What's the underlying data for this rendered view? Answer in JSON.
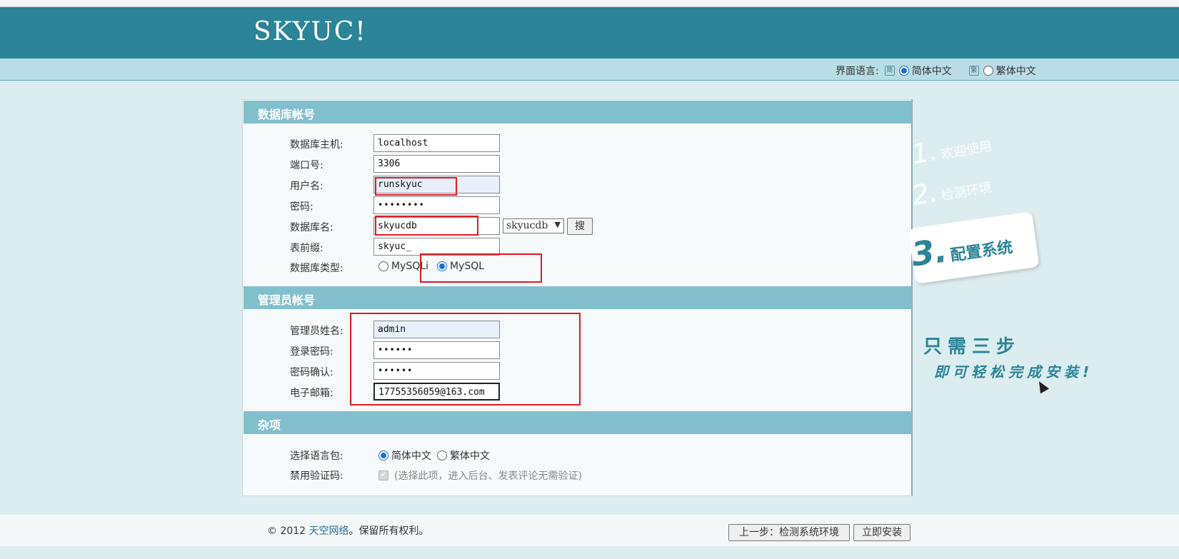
{
  "brand": {
    "logo": "SKYUC!"
  },
  "lang_switch": {
    "label": "界面语言:",
    "simplified_icon": "简",
    "traditional_icon": "繁",
    "options": [
      {
        "label": "简体中文",
        "checked": true
      },
      {
        "label": "繁体中文",
        "checked": false
      }
    ]
  },
  "db_section": {
    "title": "数据库帐号",
    "host_label": "数据库主机:",
    "host_value": "localhost",
    "port_label": "端口号:",
    "port_value": "3306",
    "user_label": "用户名:",
    "user_value": "runskyuc",
    "password_label": "密码:",
    "password_value": "••••••••",
    "dbname_label": "数据库名:",
    "dbname_value": "skyucdb",
    "dbname_select": "skyucdb",
    "search_button": "搜",
    "prefix_label": "表前缀:",
    "prefix_value": "skyuc_",
    "type_label": "数据库类型:",
    "type_options": [
      {
        "label": "MySQLi",
        "checked": false
      },
      {
        "label": "MySQL",
        "checked": true
      }
    ]
  },
  "admin_section": {
    "title": "管理员帐号",
    "name_label": "管理员姓名:",
    "name_value": "admin",
    "password_label": "登录密码:",
    "password_value": "••••••",
    "confirm_label": "密码确认:",
    "confirm_value": "••••••",
    "email_label": "电子邮箱:",
    "email_value": "17755356059@163.com"
  },
  "misc_section": {
    "title": "杂项",
    "langpack_label": "选择语言包:",
    "langpack_options": [
      {
        "label": "简体中文",
        "checked": true
      },
      {
        "label": "繁体中文",
        "checked": false
      }
    ],
    "captcha_label": "禁用验证码:",
    "captcha_note": "(选择此项，进入后台、发表评论无需验证)",
    "captcha_checked": true
  },
  "steps": {
    "step1_num": "1.",
    "step1_label": "欢迎使用",
    "step2_num": "2.",
    "step2_label": "检测环境",
    "step3_num": "3.",
    "step3_label": "配置系统",
    "slogan_line1": "只需三步",
    "slogan_line2": "即可轻松完成安装!"
  },
  "footer": {
    "copyright_prefix": "© 2012 ",
    "company": "天空网络",
    "copyright_suffix": "。保留所有权利。",
    "prev_button": "上一步：检测系统环境",
    "install_button": "立即安装"
  },
  "colors": {
    "header": "#2b8497",
    "section_head": "#82bfcd",
    "highlight_box": "#e01b24"
  }
}
